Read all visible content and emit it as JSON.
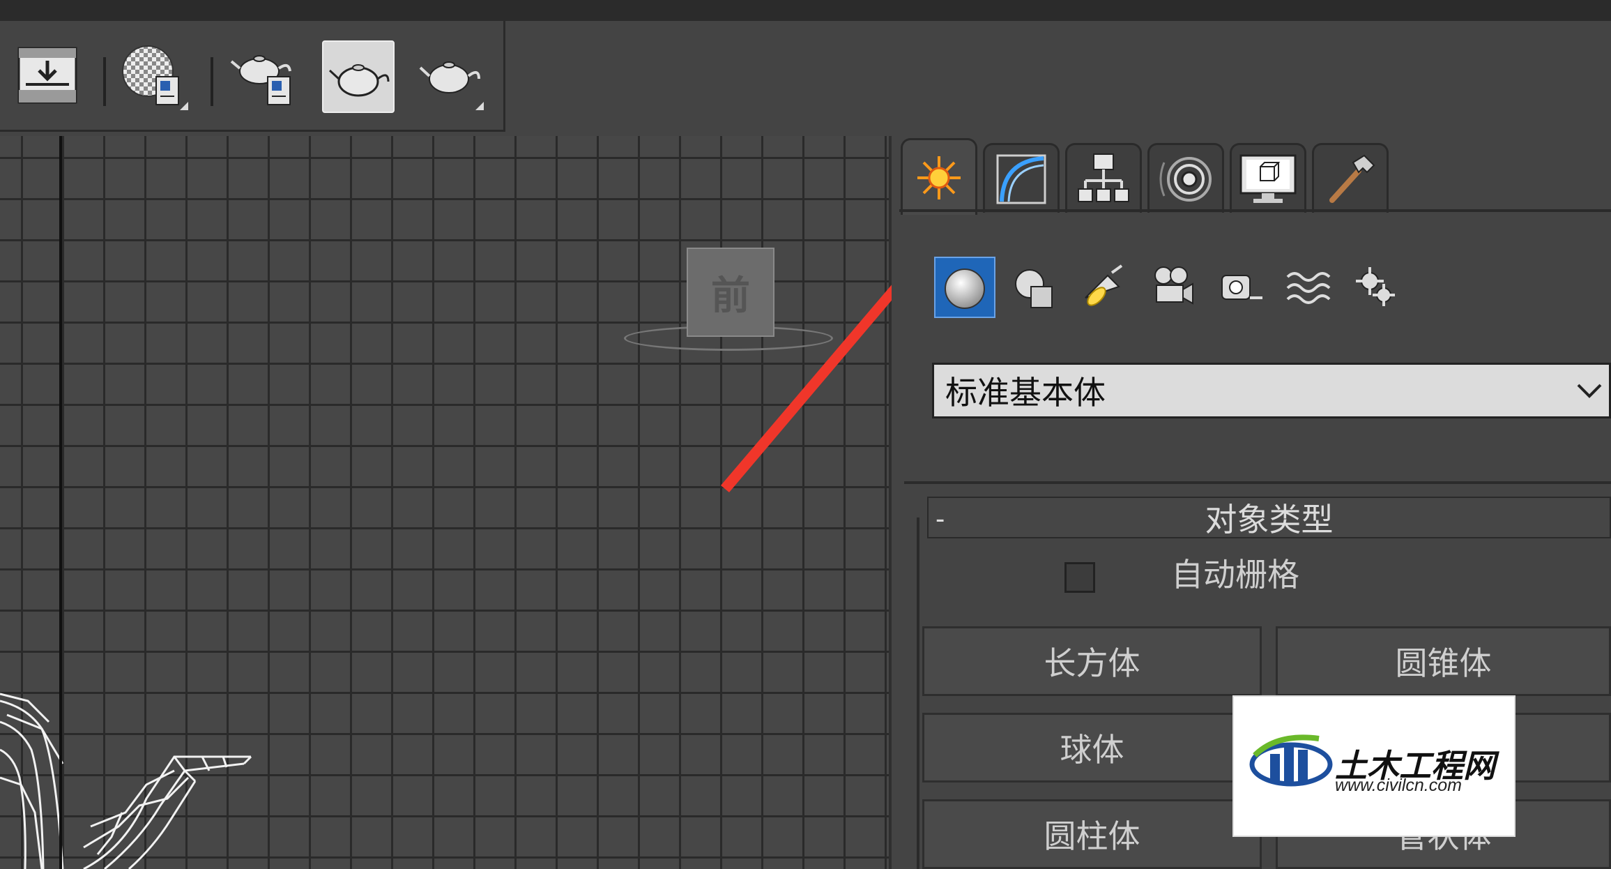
{
  "toolbar": {
    "buttons": [
      {
        "name": "render-setup-icon"
      },
      {
        "name": "material-editor-icon"
      },
      {
        "name": "rendered-frame-window-icon"
      },
      {
        "name": "render-production-icon"
      },
      {
        "name": "render-iterative-icon"
      }
    ]
  },
  "viewport": {
    "viewcube_label": "前"
  },
  "command_panel": {
    "tabs": [
      {
        "name": "tab-create",
        "icon": "create-sun-icon",
        "active": true
      },
      {
        "name": "tab-modify",
        "icon": "modify-arc-icon"
      },
      {
        "name": "tab-hierarchy",
        "icon": "hierarchy-icon"
      },
      {
        "name": "tab-motion",
        "icon": "motion-icon"
      },
      {
        "name": "tab-display",
        "icon": "display-monitor-icon"
      },
      {
        "name": "tab-utilities",
        "icon": "hammer-icon"
      }
    ],
    "subcategories": [
      {
        "name": "geometry-icon",
        "active": true
      },
      {
        "name": "shapes-icon"
      },
      {
        "name": "lights-icon"
      },
      {
        "name": "cameras-icon"
      },
      {
        "name": "helpers-icon"
      },
      {
        "name": "space-warps-icon"
      },
      {
        "name": "systems-icon"
      }
    ],
    "dropdown_value": "标准基本体",
    "rollout": {
      "collapse_symbol": "-",
      "title": "对象类型",
      "autogrid_label": "自动栅格",
      "buttons": [
        "长方体",
        "圆锥体",
        "球体",
        "圆柱体",
        "管状体"
      ]
    }
  },
  "watermark": {
    "title": "土木工程网",
    "url": "www.civilcn.com"
  },
  "colors": {
    "panel_bg": "#444444",
    "dropdown_bg": "#dcdcdc",
    "active_blue": "#1f66b8",
    "arrow_red": "#f0362a"
  }
}
